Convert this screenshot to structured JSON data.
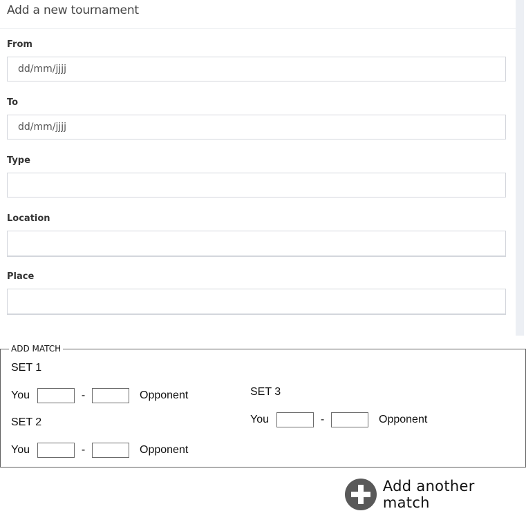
{
  "form": {
    "title": "Add a new tournament",
    "fields": [
      {
        "label": "From",
        "placeholder": "dd/mm/jjjj",
        "value": ""
      },
      {
        "label": "To",
        "placeholder": "dd/mm/jjjj",
        "value": ""
      },
      {
        "label": "Type",
        "placeholder": "",
        "value": ""
      },
      {
        "label": "Location",
        "placeholder": "",
        "value": ""
      },
      {
        "label": "Place",
        "placeholder": "",
        "value": ""
      }
    ]
  },
  "match": {
    "legend": "ADD MATCH",
    "sets": [
      {
        "title": "SET 1",
        "you_label": "You",
        "separator": "-",
        "opponent_label": "Opponent",
        "you_score": "",
        "opponent_score": ""
      },
      {
        "title": "SET 2",
        "you_label": "You",
        "separator": "-",
        "opponent_label": "Opponent",
        "you_score": "",
        "opponent_score": ""
      },
      {
        "title": "SET 3",
        "you_label": "You",
        "separator": "-",
        "opponent_label": "Opponent",
        "you_score": "",
        "opponent_score": ""
      }
    ]
  },
  "actions": {
    "add_match_label": "Add another match",
    "add_match_icon": "plus-circle-icon"
  }
}
